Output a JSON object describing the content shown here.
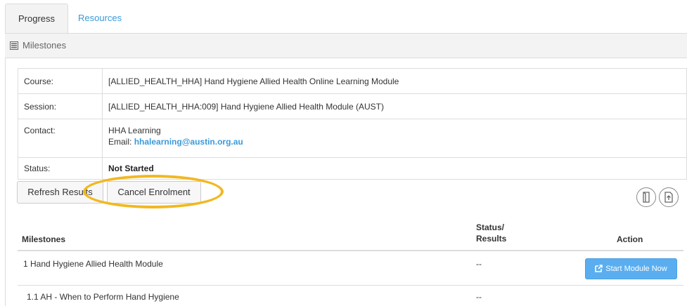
{
  "tabs": [
    {
      "label": "Progress",
      "active": true
    },
    {
      "label": "Resources",
      "active": false
    }
  ],
  "panel": {
    "title": "Milestones"
  },
  "info": {
    "course_label": "Course:",
    "course_value": "[ALLIED_HEALTH_HHA] Hand Hygiene Allied Health Online Learning Module",
    "session_label": "Session:",
    "session_value": "[ALLIED_HEALTH_HHA:009] Hand Hygiene Allied Health Module (AUST)",
    "contact_label": "Contact:",
    "contact_name": "HHA Learning",
    "contact_email_prefix": "Email: ",
    "contact_email": "hhalearning@austin.org.au",
    "status_label": "Status:",
    "status_value": "Not Started"
  },
  "buttons": {
    "refresh": "Refresh Results",
    "cancel": "Cancel Enrolment"
  },
  "milestones_table": {
    "headers": {
      "milestones": "Milestones",
      "status_line1": "Status/",
      "status_line2": "Results",
      "action": "Action"
    },
    "rows": [
      {
        "name": "1 Hand Hygiene Allied Health Module",
        "status": "--",
        "action": "Start Module Now"
      },
      {
        "name": "1.1 AH - When to Perform Hand Hygiene",
        "status": "--"
      }
    ]
  },
  "colors": {
    "accent": "#3a9ad9",
    "highlight": "#f2b821",
    "start_button": "#5aaef0"
  }
}
